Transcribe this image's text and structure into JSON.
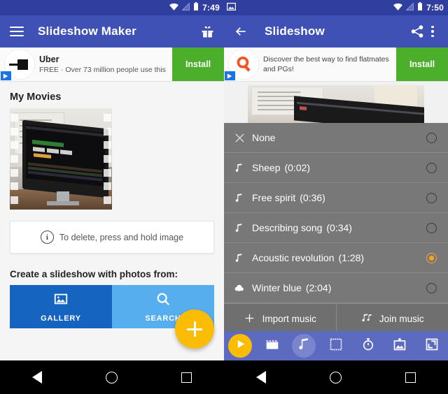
{
  "left": {
    "status_bar": {
      "time": "7:49",
      "icons": [
        "wifi-icon",
        "signal-icon",
        "battery-icon"
      ]
    },
    "app_bar": {
      "menu_icon": "hamburger-menu-icon",
      "title": "Slideshow Maker",
      "action_icon": "gift-icon"
    },
    "ad": {
      "icon": "uber-logo-icon",
      "title": "Uber",
      "subtitle": "FREE · Over 73 million people use this",
      "install_label": "Install",
      "adchoices_icon": "adchoices-icon"
    },
    "my_movies_title": "My Movies",
    "thumbnail_name": "movie-thumbnail",
    "notice": {
      "icon": "info-icon",
      "text": "To delete, press and hold image"
    },
    "create_title": "Create a slideshow with photos from:",
    "sources": [
      {
        "label": "GALLERY",
        "icon": "image-icon",
        "color": "#1565C0"
      },
      {
        "label": "SEARCH",
        "icon": "search-icon",
        "color": "#56AEEE"
      }
    ],
    "fab": {
      "icon": "plus-icon",
      "color": "#FBBC05"
    }
  },
  "right": {
    "status_bar": {
      "time": "7:50",
      "notification_icon": "photo-notification-icon",
      "icons": [
        "wifi-icon",
        "signal-icon",
        "battery-icon"
      ]
    },
    "app_bar": {
      "back_icon": "back-arrow-icon",
      "title": "Slideshow",
      "share_icon": "share-icon",
      "overflow_icon": "more-vertical-icon"
    },
    "ad": {
      "icon": "quikr-logo-icon",
      "subtitle": "Discover the best way to find flatmates and PGs!",
      "install_label": "Install",
      "adchoices_icon": "adchoices-icon"
    },
    "music_list": [
      {
        "icon": "close-icon",
        "name": "None",
        "duration": "",
        "selected": false
      },
      {
        "icon": "music-note-icon",
        "name": "Sheep",
        "duration": "(0:02)",
        "selected": false
      },
      {
        "icon": "music-note-icon",
        "name": "Free spirit",
        "duration": "(0:36)",
        "selected": false
      },
      {
        "icon": "music-note-icon",
        "name": "Describing song",
        "duration": "(0:34)",
        "selected": false
      },
      {
        "icon": "music-note-icon",
        "name": "Acoustic revolution",
        "duration": "(1:28)",
        "selected": true
      },
      {
        "icon": "cloud-download-icon",
        "name": "Winter blue",
        "duration": "(2:04)",
        "selected": false
      }
    ],
    "selected_color": "#F5A623",
    "music_actions": [
      {
        "icon": "plus-icon",
        "label": "Import music"
      },
      {
        "icon": "double-note-icon",
        "label": "Join music"
      }
    ],
    "toolbar": [
      {
        "icon": "play-icon",
        "name": "play-button",
        "active": false,
        "accent": true
      },
      {
        "icon": "clapper-icon",
        "name": "video-button",
        "active": false,
        "accent": false
      },
      {
        "icon": "music-note-icon",
        "name": "music-button",
        "active": true,
        "accent": false
      },
      {
        "icon": "frame-icon",
        "name": "frame-button",
        "active": false,
        "accent": false
      },
      {
        "icon": "timer-icon",
        "name": "duration-button",
        "active": false,
        "accent": false
      },
      {
        "icon": "add-image-icon",
        "name": "add-image-button",
        "active": false,
        "accent": false
      },
      {
        "icon": "resize-icon",
        "name": "aspect-ratio-button",
        "active": false,
        "accent": false
      }
    ]
  },
  "navbar": {
    "back": "nav-back-icon",
    "home": "nav-home-icon",
    "recents": "nav-recents-icon"
  }
}
